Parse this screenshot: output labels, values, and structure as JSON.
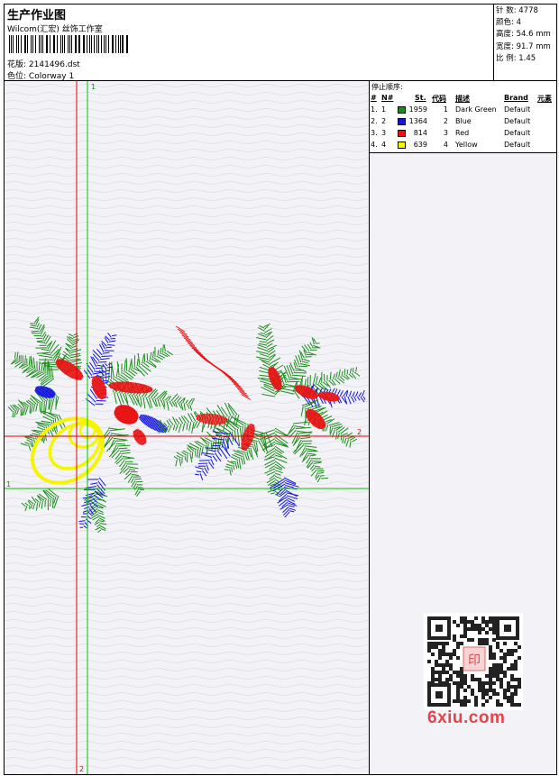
{
  "header": {
    "title": "生产作业图",
    "studio": "Wilcom(汇宏) 丝饰工作室",
    "design_label": "花版:",
    "design_value": "2141496.dst",
    "colorway_label": "色位:",
    "colorway_value": "Colorway 1"
  },
  "stats": {
    "stitches": "针 数: 4778",
    "colors": "颜色: 4",
    "height": "高度: 54.6 mm",
    "width": "宽度: 91.7 mm",
    "ratio": "比 例: 1.45"
  },
  "canvas": {
    "marker_top_green": "1",
    "marker_right_red": "2",
    "marker_left_green": "1",
    "marker_bottom_red": "2"
  },
  "stop_sequence": {
    "title": "停止顺序:",
    "headers": {
      "idx": "#",
      "no": "N#",
      "st": "St.",
      "code": "代码",
      "desc": "描述",
      "brand": "Brand",
      "elem": "元素"
    },
    "rows": [
      {
        "idx": "1.",
        "no": "1",
        "color": "#1a8c1a",
        "st": "1959",
        "code": "1",
        "desc": "Dark Green",
        "brand": "Default"
      },
      {
        "idx": "2.",
        "no": "2",
        "color": "#1414e0",
        "st": "1364",
        "code": "2",
        "desc": "Blue",
        "brand": "Default"
      },
      {
        "idx": "3.",
        "no": "3",
        "color": "#e81414",
        "st": "814",
        "code": "3",
        "desc": "Red",
        "brand": "Default"
      },
      {
        "idx": "4.",
        "no": "4",
        "color": "#f5f500",
        "st": "639",
        "code": "4",
        "desc": "Yellow",
        "brand": "Default"
      }
    ]
  },
  "watermark": {
    "text": "6xiu.com",
    "seal_text": "印"
  },
  "colors": {
    "green": "#1a8c1a",
    "blue": "#1414e0",
    "red": "#e81414",
    "yellow": "#f5f500",
    "guide_green": "#00c000",
    "guide_red": "#e00000"
  }
}
